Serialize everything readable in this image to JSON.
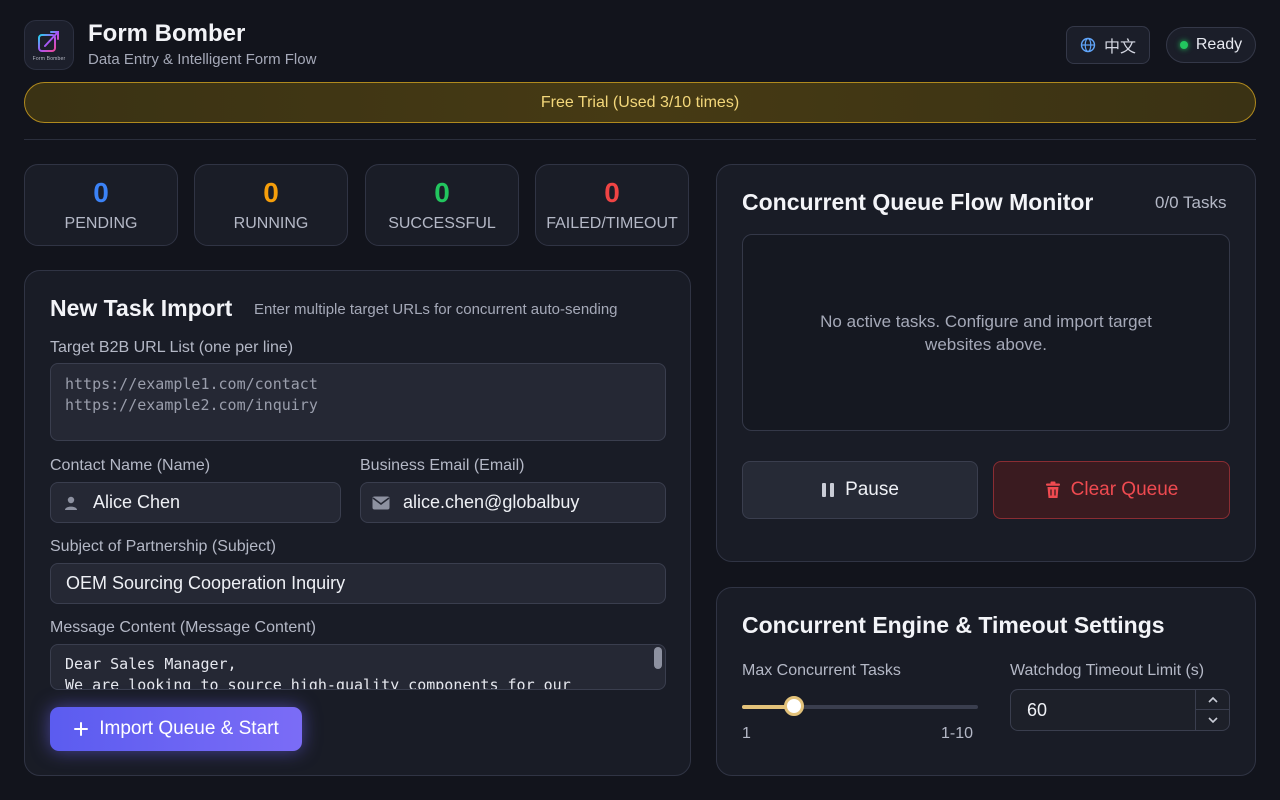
{
  "header": {
    "logo_caption": "Form Bomber",
    "title": "Form Bomber",
    "subtitle": "Data Entry & Intelligent Form Flow",
    "language_label": "中文",
    "status_label": "Ready"
  },
  "trial_banner": "Free Trial (Used 3/10 times)",
  "stats": [
    {
      "value": "0",
      "label": "PENDING",
      "color": "#3b82f6"
    },
    {
      "value": "0",
      "label": "RUNNING",
      "color": "#f59e0b"
    },
    {
      "value": "0",
      "label": "SUCCESSFUL",
      "color": "#22c55e"
    },
    {
      "value": "0",
      "label": "FAILED/TIMEOUT",
      "color": "#ef4444"
    }
  ],
  "task_import": {
    "title": "New Task Import",
    "description": "Enter multiple target URLs for concurrent auto-sending",
    "url_label": "Target B2B URL List (one per line)",
    "url_placeholder": "https://example1.com/contact\nhttps://example2.com/inquiry",
    "name_label": "Contact Name (Name)",
    "name_value": "Alice Chen",
    "email_label": "Business Email (Email)",
    "email_value": "alice.chen@globalbuy",
    "subject_label": "Subject of Partnership (Subject)",
    "subject_value": "OEM Sourcing Cooperation Inquiry",
    "message_label": "Message Content (Message Content)",
    "message_value": "Dear Sales Manager,\nWe are looking to source high-quality components for our",
    "import_button": "Import Queue & Start"
  },
  "monitor": {
    "title": "Concurrent Queue Flow Monitor",
    "task_count": "0/0 Tasks",
    "empty_message": "No active tasks. Configure and import target websites above.",
    "pause_button": "Pause",
    "clear_button": "Clear Queue"
  },
  "settings": {
    "title": "Concurrent Engine & Timeout Settings",
    "max_tasks_label": "Max Concurrent Tasks",
    "slider_min_label": "1",
    "slider_range_label": "1-10",
    "slider_value": 3,
    "slider_min": 1,
    "slider_max": 10,
    "timeout_label": "Watchdog Timeout Limit (s)",
    "timeout_value": "60"
  }
}
